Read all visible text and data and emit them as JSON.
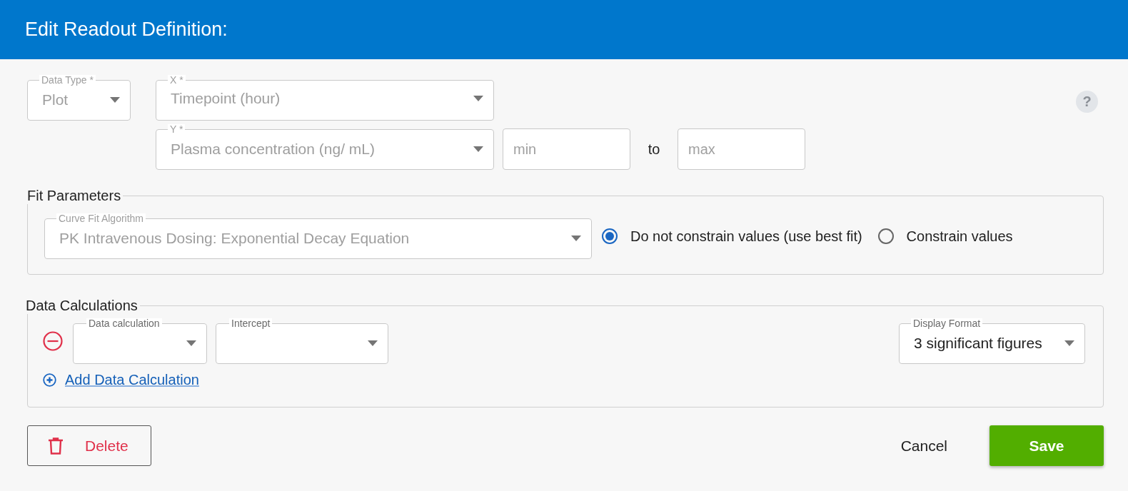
{
  "dialog": {
    "title": "Edit Readout Definition:"
  },
  "help": {
    "symbol": "?"
  },
  "data_type": {
    "label": "Data Type *",
    "value": "Plot",
    "disabled": true
  },
  "x_axis": {
    "label": "X *",
    "value": "Timepoint (hour)",
    "disabled": true
  },
  "y_axis": {
    "label": "Y *",
    "value": "Plasma concentration (ng/ mL)",
    "disabled": true,
    "min": {
      "placeholder": "min"
    },
    "separator": "to",
    "max": {
      "placeholder": "max"
    }
  },
  "fit_parameters": {
    "legend": "Fit Parameters",
    "algorithm": {
      "label": "Curve Fit Algorithm",
      "value": "PK Intravenous Dosing: Exponential Decay Equation",
      "disabled": true
    },
    "options": [
      {
        "label": "Do not constrain values (use best fit)",
        "selected": true
      },
      {
        "label": "Constrain values",
        "selected": false
      }
    ]
  },
  "data_calculations": {
    "legend": "Data Calculations",
    "rows": [
      {
        "calculation": {
          "label": "Data calculation",
          "disabled": false
        },
        "source": {
          "label": "Intercept",
          "disabled": false
        }
      }
    ],
    "display_format": {
      "label": "Display Format",
      "value": "3 significant figures",
      "disabled": false
    },
    "add_link": "Add Data Calculation"
  },
  "buttons": {
    "delete": "Delete",
    "cancel": "Cancel",
    "save": "Save"
  }
}
